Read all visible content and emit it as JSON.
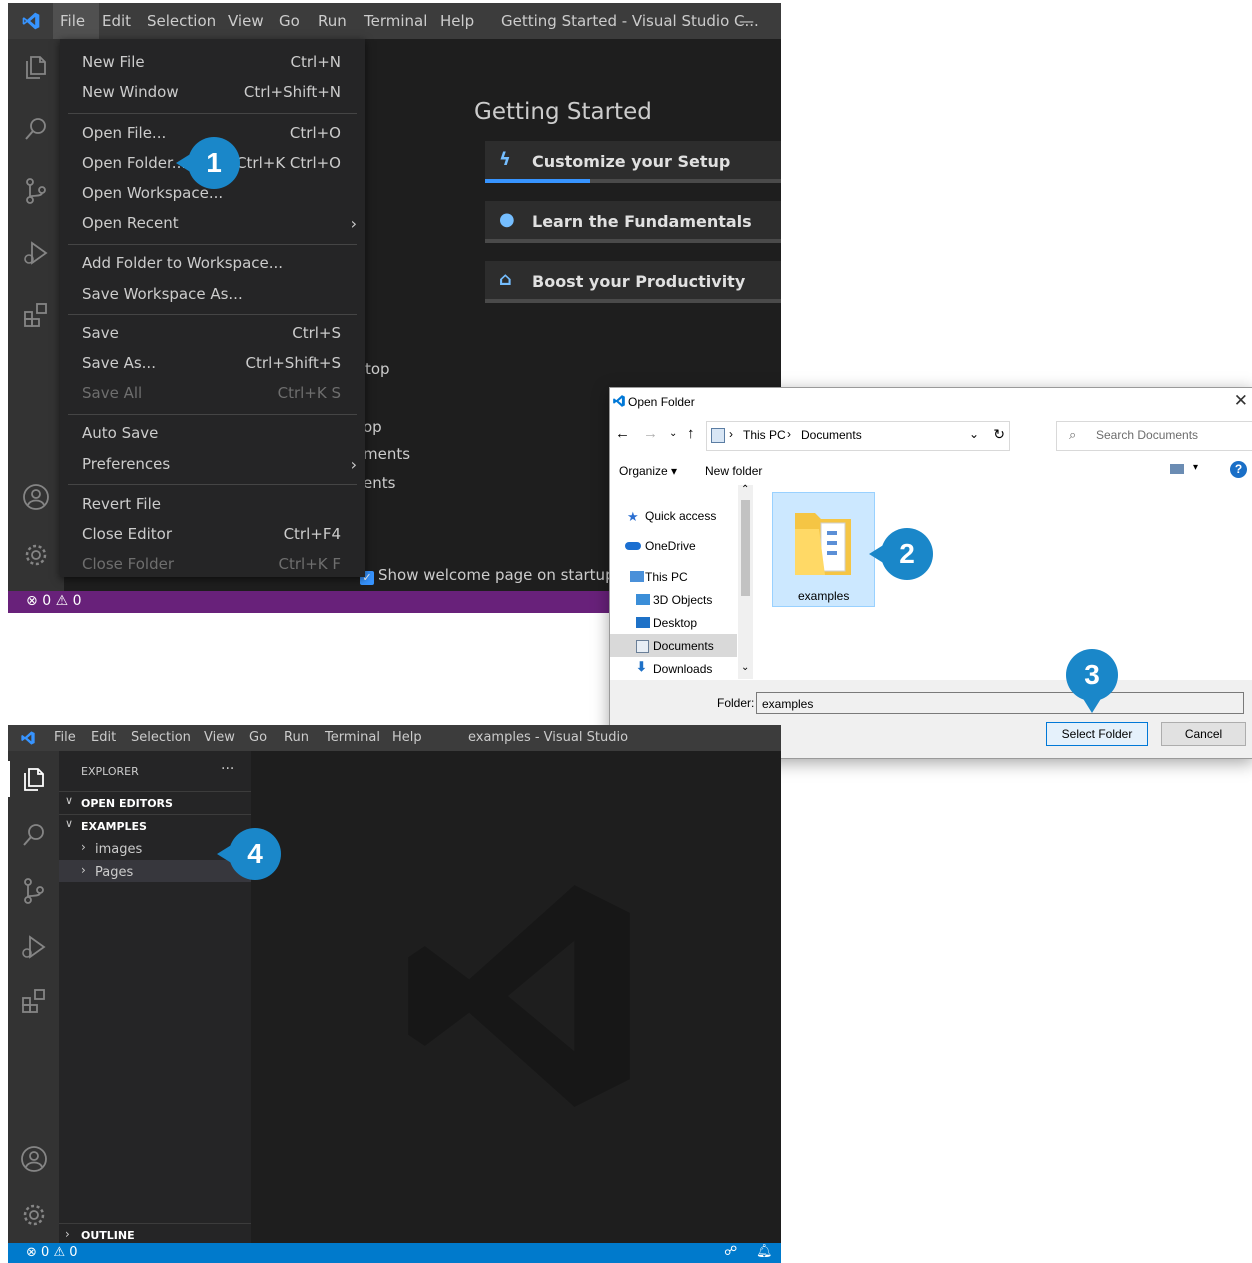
{
  "vscode1": {
    "menu": [
      "File",
      "Edit",
      "Selection",
      "View",
      "Go",
      "Run",
      "Terminal",
      "Help"
    ],
    "window_title": "Getting Started - Visual Studio C...",
    "minimize": "—",
    "file_menu": {
      "new_file": {
        "label": "New File",
        "shortcut": "Ctrl+N"
      },
      "new_window": {
        "label": "New Window",
        "shortcut": "Ctrl+Shift+N"
      },
      "open_file": {
        "label": "Open File...",
        "shortcut": "Ctrl+O"
      },
      "open_folder": {
        "label": "Open Folder...",
        "shortcut": "Ctrl+K Ctrl+O"
      },
      "open_workspace": {
        "label": "Open Workspace..."
      },
      "open_recent": {
        "label": "Open Recent"
      },
      "add_folder": {
        "label": "Add Folder to Workspace..."
      },
      "save_workspace_as": {
        "label": "Save Workspace As..."
      },
      "save": {
        "label": "Save",
        "shortcut": "Ctrl+S"
      },
      "save_as": {
        "label": "Save As...",
        "shortcut": "Ctrl+Shift+S"
      },
      "save_all": {
        "label": "Save All",
        "shortcut": "Ctrl+K S"
      },
      "auto_save": {
        "label": "Auto Save"
      },
      "preferences": {
        "label": "Preferences"
      },
      "revert_file": {
        "label": "Revert File"
      },
      "close_editor": {
        "label": "Close Editor",
        "shortcut": "Ctrl+F4"
      },
      "close_folder": {
        "label": "Close Folder",
        "shortcut": "Ctrl+K F"
      }
    },
    "getting_started": {
      "title": "Getting Started",
      "cards": [
        {
          "label": "Customize your Setup",
          "icon": "lightning-icon",
          "progress": 0.35
        },
        {
          "label": "Learn the Fundamentals",
          "icon": "lightbulb-icon",
          "progress": 0.0
        },
        {
          "label": "Boost your Productivity",
          "icon": "mortarboard-icon",
          "progress": 0.0
        }
      ],
      "fragments": [
        "top",
        "op",
        "ments",
        "ents"
      ],
      "show_welcome": "Show welcome page on startup"
    },
    "status": {
      "errors": "0",
      "warnings": "0",
      "color": "#68217a"
    }
  },
  "dialog": {
    "title": "Open Folder",
    "close": "✕",
    "breadcrumb": [
      "This PC",
      "Documents"
    ],
    "search_placeholder": "Search Documents",
    "organize": "Organize",
    "new_folder": "New folder",
    "nav_items": [
      "Quick access",
      "OneDrive",
      "This PC",
      "3D Objects",
      "Desktop",
      "Documents",
      "Downloads"
    ],
    "folder_name": "examples",
    "folder_label": "Folder:",
    "folder_value": "examples",
    "select_button": "Select Folder",
    "cancel_button": "Cancel"
  },
  "vscode2": {
    "menu": [
      "File",
      "Edit",
      "Selection",
      "View",
      "Go",
      "Run",
      "Terminal",
      "Help"
    ],
    "window_title": "examples - Visual Studio",
    "explorer": {
      "title": "EXPLORER",
      "more": "···",
      "open_editors": "OPEN EDITORS",
      "examples": "EXAMPLES",
      "items": [
        "images",
        "Pages"
      ],
      "outline": "OUTLINE"
    },
    "status": {
      "errors": "0",
      "warnings": "0",
      "color": "#007acc"
    }
  },
  "callouts": [
    "1",
    "2",
    "3",
    "4"
  ],
  "colors": {
    "accent": "#1a87c9",
    "link": "#3794ff"
  }
}
